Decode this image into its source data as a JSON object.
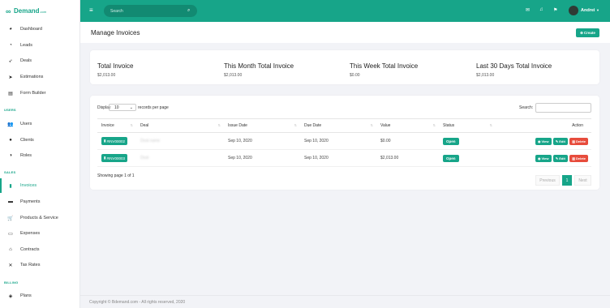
{
  "brand": {
    "name": "Demand",
    "suffix": ".com"
  },
  "sidebar": {
    "sections": [
      "USERS",
      "SALES",
      "BILLING"
    ],
    "items": [
      {
        "label": "Dashboard",
        "icon": "palette-icon"
      },
      {
        "label": "Leads",
        "icon": "pie-chart-icon"
      },
      {
        "label": "Deals",
        "icon": "rocket-icon"
      },
      {
        "label": "Estimations",
        "icon": "send-icon"
      },
      {
        "label": "Form Builder",
        "icon": "clipboard-icon"
      },
      {
        "label": "Users",
        "icon": "users-icon"
      },
      {
        "label": "Clients",
        "icon": "clients-icon"
      },
      {
        "label": "Roles",
        "icon": "roles-icon"
      },
      {
        "label": "Invoices",
        "icon": "invoice-icon"
      },
      {
        "label": "Payments",
        "icon": "payments-icon"
      },
      {
        "label": "Products & Service",
        "icon": "cart-icon"
      },
      {
        "label": "Expenses",
        "icon": "expenses-icon"
      },
      {
        "label": "Contracts",
        "icon": "handshake-icon"
      },
      {
        "label": "Tax Rates",
        "icon": "percent-icon"
      },
      {
        "label": "Plans",
        "icon": "plans-icon"
      }
    ]
  },
  "topbar": {
    "search_placeholder": "Search",
    "user_name": "Andrei"
  },
  "page": {
    "title": "Manage Invoices",
    "create_label": "Create"
  },
  "stats": [
    {
      "title": "Total Invoice",
      "value": "$2,013.00"
    },
    {
      "title": "This Month Total Invoice",
      "value": "$2,013.00"
    },
    {
      "title": "This Week Total Invoice",
      "value": "$0.00"
    },
    {
      "title": "Last 30 Days Total Invoice",
      "value": "$2,013.00"
    }
  ],
  "table_controls": {
    "display_label": "Display",
    "per_page_value": "10",
    "per_page_suffix": "records per page",
    "search_label": "Search:"
  },
  "table": {
    "headers": [
      "Invoice",
      "Deal",
      "Issue Date",
      "Due Date",
      "Value",
      "Status",
      "Action"
    ],
    "rows": [
      {
        "invoice": "#INV00002",
        "deal": "Deal name",
        "issue_date": "Sep 10, 2020",
        "due_date": "Sep 10, 2020",
        "value": "$0.00",
        "status": "Open"
      },
      {
        "invoice": "#INV00003",
        "deal": "Deal",
        "issue_date": "Sep 10, 2020",
        "due_date": "Sep 10, 2020",
        "value": "$2,013.00",
        "status": "Open"
      }
    ],
    "actions": {
      "view": "View",
      "edit": "Edit",
      "delete": "Delete"
    }
  },
  "pagination": {
    "info": "Showing page 1 of 1",
    "previous": "Previous",
    "page": "1",
    "next": "Next"
  },
  "footer": {
    "text": "Copyright © Bdemand.com - All rights reserved, 2020"
  },
  "colors": {
    "accent": "#17a589",
    "danger": "#e74c3c"
  }
}
